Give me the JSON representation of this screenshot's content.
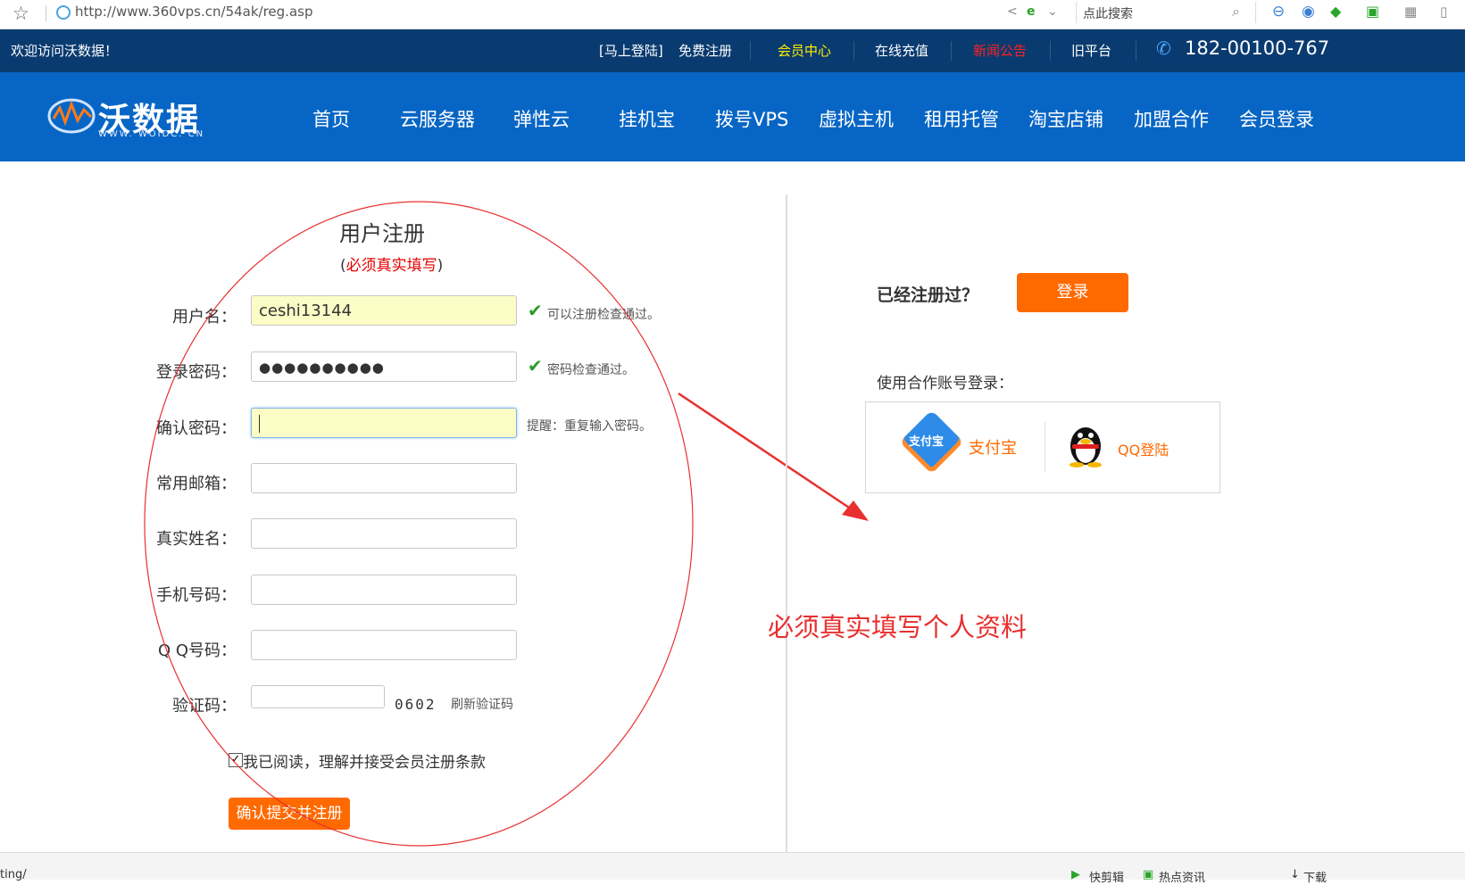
{
  "browser": {
    "url": "http://www.360vps.cn/54ak/reg.asp",
    "search_placeholder": "点此搜索"
  },
  "topbar": {
    "welcome": "欢迎访问沃数据！",
    "login_link": "[马上登陆]",
    "register_link": "免费注册",
    "member_center": "会员中心",
    "recharge": "在线充值",
    "news": "新闻公告",
    "old_platform": "旧平台",
    "phone": "182-00100-767",
    "colors": {
      "bg": "#0a3b70",
      "member": "#ffee00",
      "news": "#ff2020"
    }
  },
  "logo": {
    "name": "沃数据",
    "domain": "WWW. WOIDC. CN"
  },
  "nav": {
    "items": [
      "首页",
      "云服务器",
      "弹性云",
      "挂机宝",
      "拨号VPS",
      "虚拟主机",
      "租用托管",
      "淘宝店铺",
      "加盟合作",
      "会员登录"
    ]
  },
  "form": {
    "title": "用户注册",
    "subtitle_open": "(",
    "subtitle": "必须真实填写",
    "subtitle_close": ")",
    "fields": {
      "username": {
        "label": "用户名：",
        "value": "ceshi13144",
        "hint": "可以注册检查通过。"
      },
      "password": {
        "label": "登录密码：",
        "value": "●●●●●●●●●●",
        "hint": "密码检查通过。"
      },
      "confirm": {
        "label": "确认密码：",
        "value": "",
        "hint": "提醒：重复输入密码。"
      },
      "email": {
        "label": "常用邮箱：",
        "value": ""
      },
      "realname": {
        "label": "真实姓名：",
        "value": ""
      },
      "mobile": {
        "label": "手机号码：",
        "value": ""
      },
      "qq": {
        "label": "Q Q号码：",
        "value": ""
      },
      "captcha": {
        "label": "验证码：",
        "value": "",
        "code": "0602",
        "refresh": "刷新验证码"
      }
    },
    "agree_text": "我已阅读，理解并接受会员注册条款",
    "agree_checked": true,
    "submit": "确认提交并注册"
  },
  "right": {
    "already_registered": "已经注册过？",
    "login_button": "登录",
    "partner_login": "使用合作账号登录：",
    "alipay_badge": "支付宝",
    "alipay": "支付宝",
    "qq": "QQ登陆"
  },
  "annotation": {
    "text": "必须真实填写个人资料",
    "color": "#e83030"
  },
  "statusbar": {
    "left": "ting/",
    "items": [
      "快剪辑",
      "热点资讯",
      "下载"
    ]
  }
}
